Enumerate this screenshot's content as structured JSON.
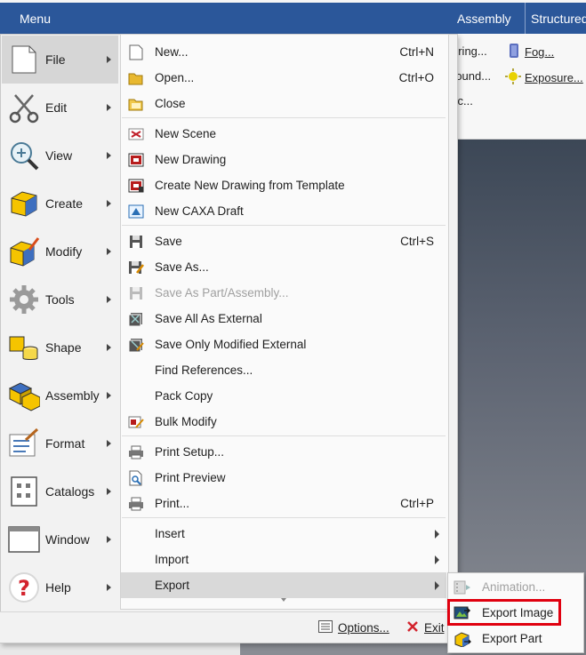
{
  "menu_button": "Menu",
  "ribbon": {
    "tabs": [
      "Assembly",
      "Structured"
    ],
    "buttons": [
      "ering...",
      "Fog...",
      "round...",
      "Exposure...",
      "tic..."
    ]
  },
  "left_panel": [
    {
      "label": "File",
      "icon": "file-icon",
      "active": true
    },
    {
      "label": "Edit",
      "icon": "scissors-icon"
    },
    {
      "label": "View",
      "icon": "zoom-view-icon"
    },
    {
      "label": "Create",
      "icon": "create-cube-icon"
    },
    {
      "label": "Modify",
      "icon": "modify-cube-icon"
    },
    {
      "label": "Tools",
      "icon": "gear-icon"
    },
    {
      "label": "Shape",
      "icon": "shape-icon"
    },
    {
      "label": "Assembly",
      "icon": "assembly-icon"
    },
    {
      "label": "Format",
      "icon": "format-brush-icon"
    },
    {
      "label": "Catalogs",
      "icon": "catalogs-icon"
    },
    {
      "label": "Window",
      "icon": "window-icon"
    },
    {
      "label": "Help",
      "icon": "help-icon"
    }
  ],
  "file_menu": {
    "new": {
      "label": "New...",
      "shortcut": "Ctrl+N"
    },
    "open": {
      "label": "Open...",
      "shortcut": "Ctrl+O"
    },
    "close": {
      "label": "Close"
    },
    "new_scene": {
      "label": "New Scene"
    },
    "new_drawing": {
      "label": "New Drawing"
    },
    "new_drawing_template": {
      "label": "Create New Drawing from Template"
    },
    "new_caxa": {
      "label": "New CAXA Draft"
    },
    "save": {
      "label": "Save",
      "shortcut": "Ctrl+S"
    },
    "save_as": {
      "label": "Save As..."
    },
    "save_as_part": {
      "label": "Save As Part/Assembly..."
    },
    "save_all_external": {
      "label": "Save All As External"
    },
    "save_modified_external": {
      "label": "Save Only Modified External"
    },
    "find_references": {
      "label": "Find References..."
    },
    "pack_copy": {
      "label": "Pack Copy"
    },
    "bulk_modify": {
      "label": "Bulk Modify"
    },
    "print_setup": {
      "label": "Print Setup..."
    },
    "print_preview": {
      "label": "Print Preview"
    },
    "print": {
      "label": "Print...",
      "shortcut": "Ctrl+P"
    },
    "insert": {
      "label": "Insert"
    },
    "import": {
      "label": "Import"
    },
    "export": {
      "label": "Export"
    }
  },
  "footer": {
    "options": "Options...",
    "exit": "Exit"
  },
  "export_flyout": {
    "animation": "Animation...",
    "export_image": "Export Image",
    "export_part": "Export Part"
  },
  "colors": {
    "accent": "#2b579a",
    "highlight_box": "#e0000f"
  }
}
